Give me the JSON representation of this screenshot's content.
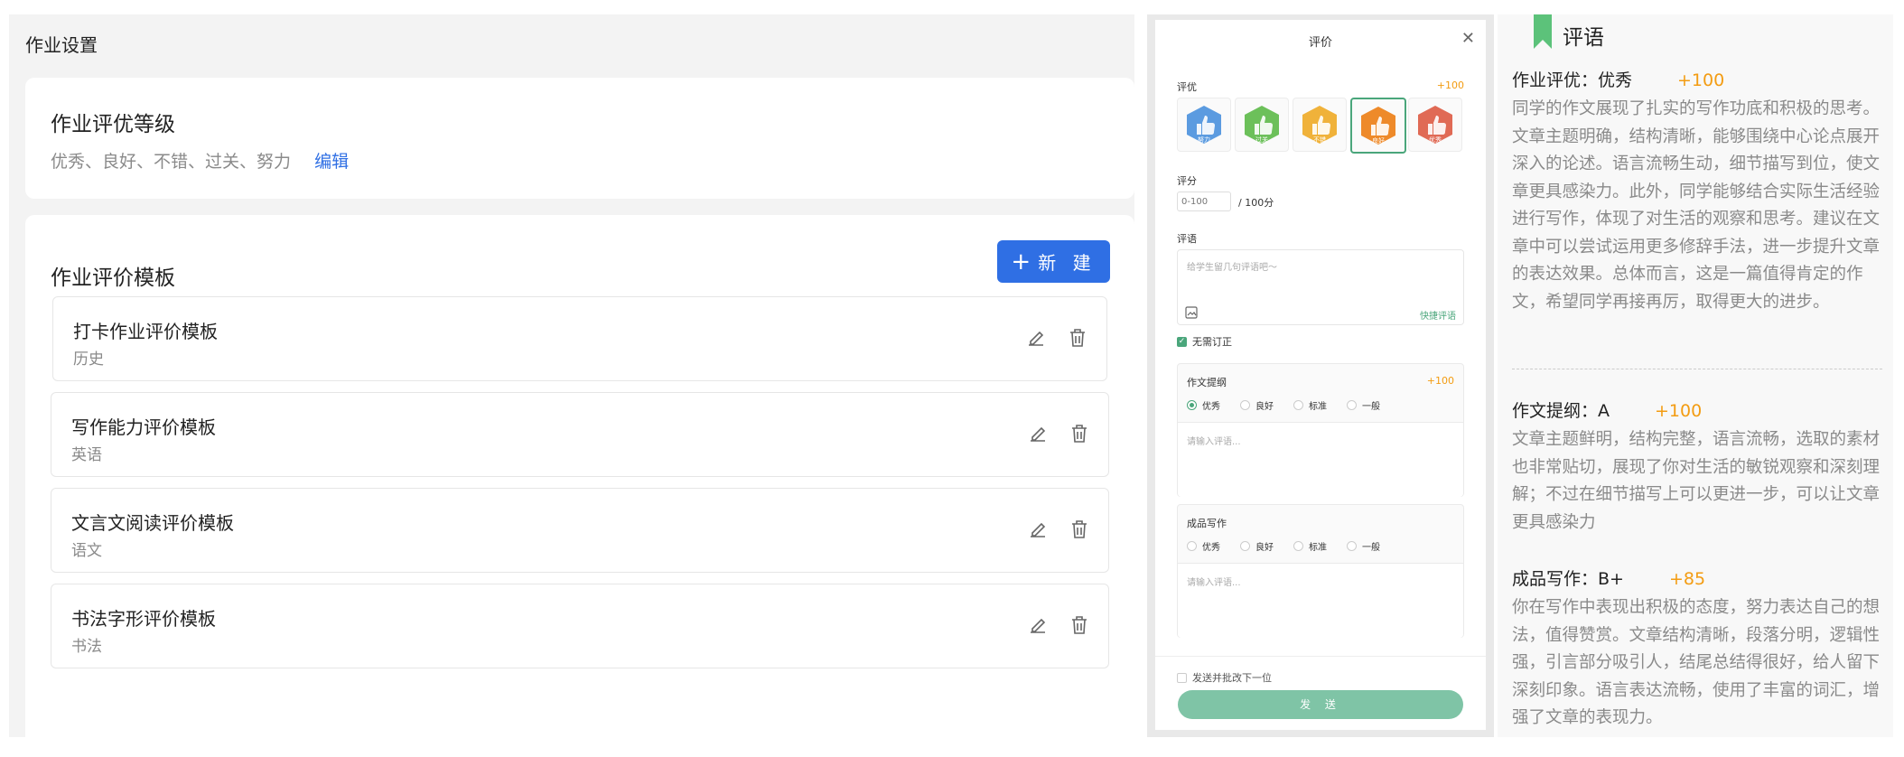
{
  "settings": {
    "page_title": "作业设置",
    "level_card": {
      "title": "作业评优等级",
      "levels_text": "优秀、良好、不错、过关、努力",
      "edit_label": "编辑"
    },
    "template_card": {
      "title": "作业评价模板",
      "new_button_label": "新 建",
      "templates": [
        {
          "name": "打卡作业评价模板",
          "subject": "历史"
        },
        {
          "name": "写作能力评价模板",
          "subject": "英语"
        },
        {
          "name": "文言文阅读评价模板",
          "subject": "语文"
        },
        {
          "name": "书法字形评价模板",
          "subject": "书法"
        }
      ]
    }
  },
  "dialog": {
    "title": "评价",
    "close_icon": "close-icon",
    "rating_label": "评优",
    "rating_score": "+100",
    "badges": [
      {
        "label": "努力",
        "color": "#5b9be0",
        "selected": false
      },
      {
        "label": "过关",
        "color": "#6cc05a",
        "selected": false
      },
      {
        "label": "不错",
        "color": "#f0b23a",
        "selected": false
      },
      {
        "label": "良好",
        "color": "#ee8a2a",
        "selected": true
      },
      {
        "label": "优秀",
        "color": "#e06a55",
        "selected": false
      }
    ],
    "score_label": "评分",
    "score_placeholder": "0-100",
    "score_unit": "/ 100分",
    "comment_label": "评语",
    "comment_placeholder": "给学生留几句评语吧～",
    "quick_comment_label": "快捷评语",
    "no_correction_label": "无需订正",
    "no_correction_checked": true,
    "rubric_options": [
      "优秀",
      "良好",
      "标准",
      "一般"
    ],
    "sections": [
      {
        "title": "作文提纲",
        "score": "+100",
        "selected": "优秀",
        "placeholder": "请输入评语..."
      },
      {
        "title": "成品写作",
        "score": "",
        "selected": "",
        "placeholder": "请输入评语..."
      }
    ],
    "send_next_label": "发送并批改下一位",
    "send_button_label": "发 送",
    "accent_color": "#4aa67b",
    "score_color": "#f39c12"
  },
  "comments": {
    "header": "评语",
    "blocks": [
      {
        "heading": "作业评优：优秀",
        "score": "+100",
        "text": "同学的作文展现了扎实的写作功底和积极的思考。文章主题明确，结构清晰，能够围绕中心论点展开深入的论述。语言流畅生动，细节描写到位，使文章更具感染力。此外，同学能够结合实际生活经验进行写作，体现了对生活的观察和思考。建议在文章中可以尝试运用更多修辞手法，进一步提升文章的表达效果。总体而言，这是一篇值得肯定的作文，希望同学再接再厉，取得更大的进步。"
      },
      {
        "heading": "作文提纲：A",
        "score": "+100",
        "text": "文章主题鲜明，结构完整，语言流畅，选取的素材也非常贴切，展现了你对生活的敏锐观察和深刻理解；不过在细节描写上可以更进一步，可以让文章更具感染力"
      },
      {
        "heading": "成品写作：B+",
        "score": "+85",
        "text": "你在写作中表现出积极的态度，努力表达自己的想法，值得赞赏。文章结构清晰，段落分明，逻辑性强，引言部分吸引人，结尾总结得很好，给人留下深刻印象。语言表达流畅，使用了丰富的词汇，增强了文章的表现力。"
      }
    ]
  }
}
